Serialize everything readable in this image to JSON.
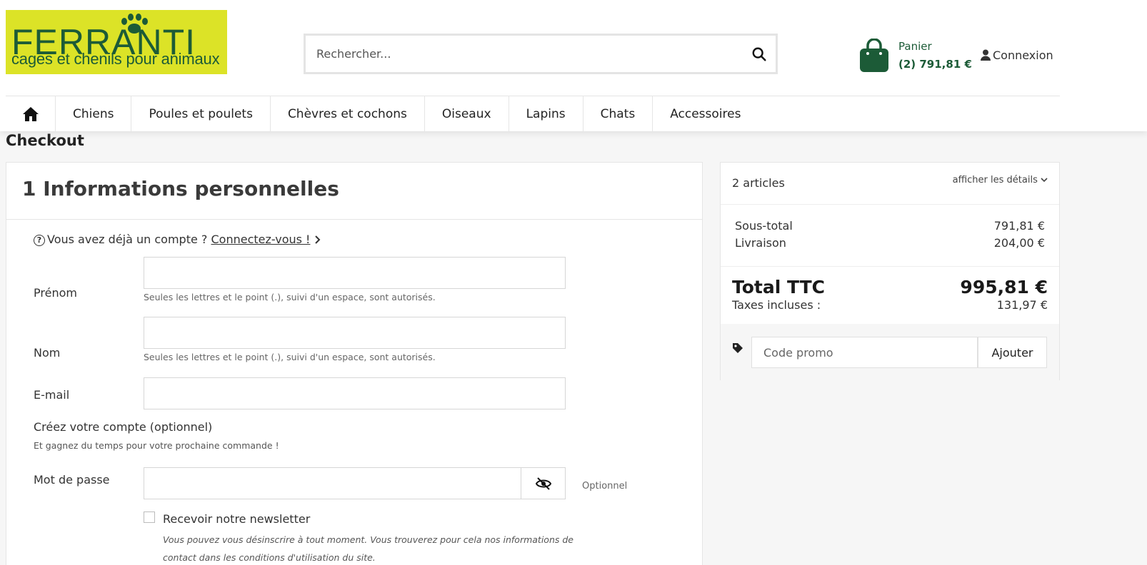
{
  "header": {
    "logo": {
      "brand": "FERRANTI",
      "tagline": "cages et chenils pour animaux",
      "color": "#1c5b37",
      "background": "#dce327"
    },
    "search": {
      "placeholder": "Rechercher...",
      "icon": "search-icon"
    },
    "cart": {
      "label": "Panier",
      "total": "(2) 791,81 €",
      "icon": "shopping-bag-icon",
      "color": "#1c5b37"
    },
    "login": {
      "label": "Connexion",
      "icon": "user-icon"
    }
  },
  "nav": {
    "home_icon": "home-icon",
    "items": [
      {
        "label": "Chiens"
      },
      {
        "label": "Poules et poulets"
      },
      {
        "label": "Chèvres et cochons"
      },
      {
        "label": "Oiseaux"
      },
      {
        "label": "Lapins"
      },
      {
        "label": "Chats"
      },
      {
        "label": "Accessoires"
      }
    ]
  },
  "page": {
    "title": "Checkout"
  },
  "personal_info": {
    "step_title": "1 Informations personnelles",
    "already_account": "Vous avez déjà un compte ?",
    "login_link": "Connectez-vous !",
    "fields": {
      "firstname": {
        "label": "Prénom",
        "hint": "Seules les lettres et le point (.), suivi d'un espace, sont autorisés.",
        "value": ""
      },
      "lastname": {
        "label": "Nom",
        "hint": "Seules les lettres et le point (.), suivi d'un espace, sont autorisés.",
        "value": ""
      },
      "email": {
        "label": "E-mail",
        "value": ""
      }
    },
    "create_account": {
      "title": "Créez votre compte (optionnel)",
      "subtitle": "Et gagnez du temps pour votre prochaine commande !"
    },
    "password": {
      "label": "Mot de passe",
      "optional": "Optionnel",
      "toggle_icon": "eye-slash-icon",
      "value": ""
    },
    "newsletter": {
      "label": "Recevoir notre newsletter",
      "hint": "Vous pouvez vous désinscrire à tout moment. Vous trouverez pour cela nos informations de contact dans les conditions d'utilisation du site.",
      "checked": false
    }
  },
  "summary": {
    "count": "2 articles",
    "details_link": "afficher les détails",
    "subtotal": {
      "label": "Sous-total",
      "value": "791,81 €"
    },
    "shipping": {
      "label": "Livraison",
      "value": "204,00 €"
    },
    "total": {
      "label": "Total TTC",
      "value": "995,81 €"
    },
    "taxes": {
      "label": "Taxes incluses :",
      "value": "131,97 €"
    },
    "promo": {
      "placeholder": "Code promo",
      "button": "Ajouter",
      "icon": "tag-icon"
    }
  }
}
